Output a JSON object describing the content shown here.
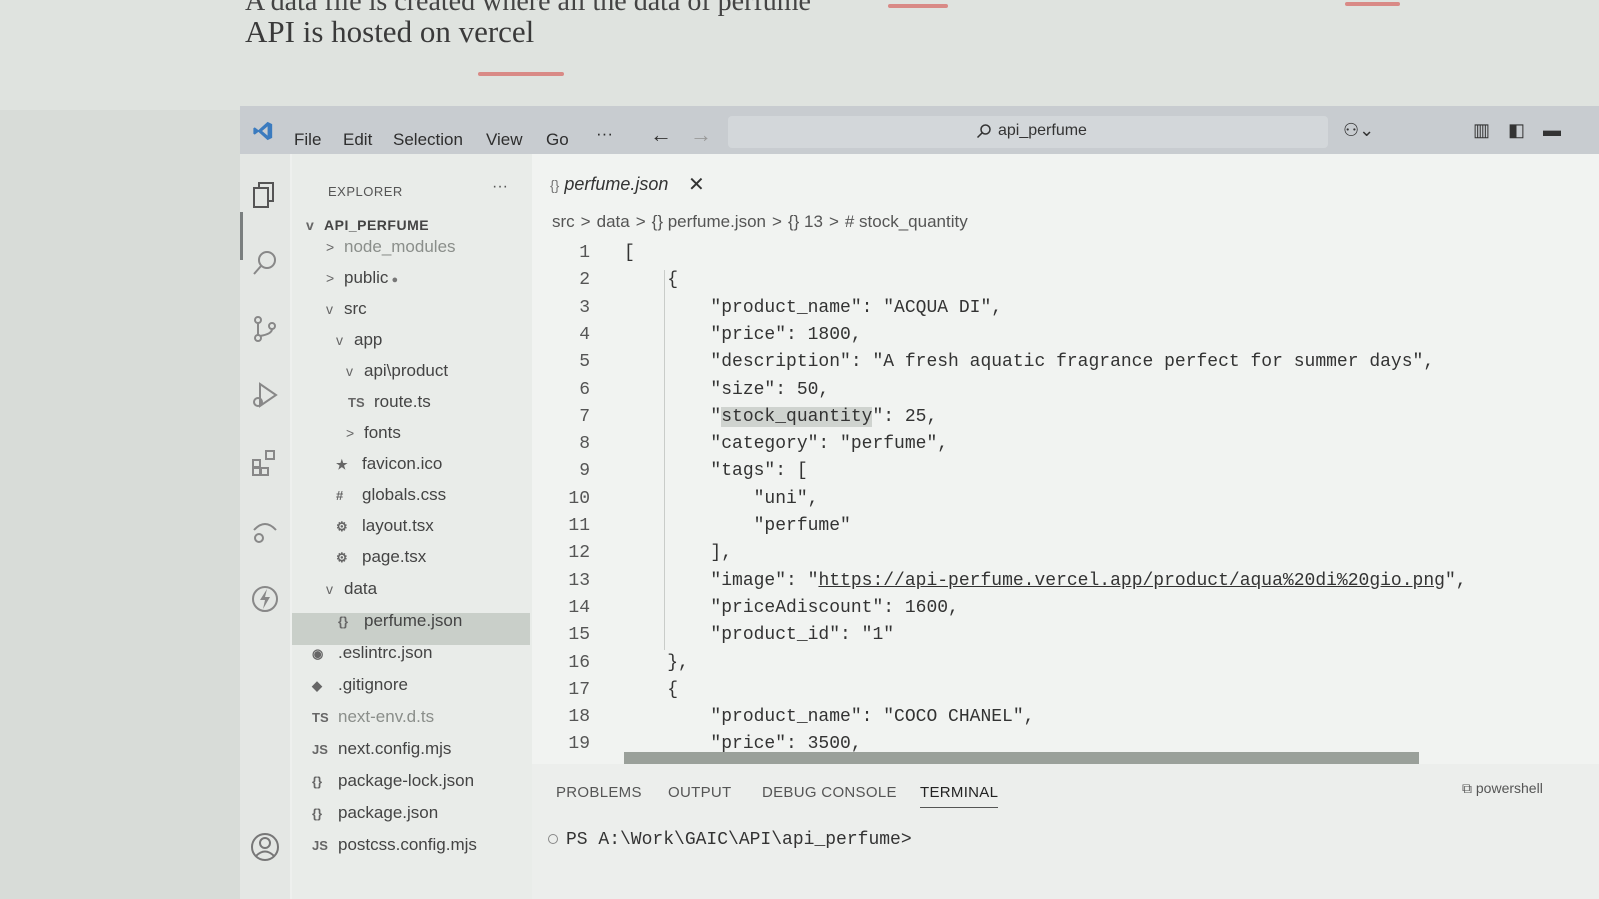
{
  "slide": {
    "partial_title": "A data file is created where all the data of perfume",
    "title": "API is hosted on vercel"
  },
  "titlebar": {
    "menu": [
      "File",
      "Edit",
      "Selection",
      "View",
      "Go",
      "···"
    ],
    "search": "api_perfume"
  },
  "explorer": {
    "header": "EXPLORER",
    "more": "···",
    "root": "API_PERFUME",
    "items": [
      {
        "label": "node_modules",
        "twisty": ">",
        "icon": "",
        "dim": true
      },
      {
        "label": "public",
        "twisty": ">",
        "icon": "",
        "dim": false
      },
      {
        "label": "src",
        "twisty": "v",
        "icon": "",
        "dim": false
      },
      {
        "label": "app",
        "twisty": "v",
        "icon": "",
        "dim": false
      },
      {
        "label": "api\\product",
        "twisty": "v",
        "icon": "",
        "dim": false
      },
      {
        "label": "route.ts",
        "twisty": "",
        "icon": "TS",
        "dim": false
      },
      {
        "label": "fonts",
        "twisty": ">",
        "icon": "",
        "dim": false
      },
      {
        "label": "favicon.ico",
        "twisty": "",
        "icon": "★",
        "dim": false
      },
      {
        "label": "globals.css",
        "twisty": "",
        "icon": "#",
        "dim": false
      },
      {
        "label": "layout.tsx",
        "twisty": "",
        "icon": "⚙",
        "dim": false
      },
      {
        "label": "page.tsx",
        "twisty": "",
        "icon": "⚙",
        "dim": false
      },
      {
        "label": "data",
        "twisty": "v",
        "icon": "",
        "dim": false
      },
      {
        "label": "perfume.json",
        "twisty": "",
        "icon": "{}",
        "dim": false
      },
      {
        "label": ".eslintrc.json",
        "twisty": "",
        "icon": "◉",
        "dim": false
      },
      {
        "label": ".gitignore",
        "twisty": "",
        "icon": "◆",
        "dim": false
      },
      {
        "label": "next-env.d.ts",
        "twisty": "",
        "icon": "TS",
        "dim": true
      },
      {
        "label": "next.config.mjs",
        "twisty": "",
        "icon": "JS",
        "dim": false
      },
      {
        "label": "package-lock.json",
        "twisty": "",
        "icon": "{}",
        "dim": false
      },
      {
        "label": "package.json",
        "twisty": "",
        "icon": "{}",
        "dim": false
      },
      {
        "label": "postcss.config.mjs",
        "twisty": "",
        "icon": "JS",
        "dim": false
      }
    ]
  },
  "editor": {
    "tab": "perfume.json",
    "breadcrumbs": [
      "src",
      ">",
      "data",
      ">",
      "{} perfume.json",
      ">",
      "{} 13",
      ">",
      "# stock_quantity"
    ],
    "lines": [
      "[",
      "    {",
      "        \"product_name\": \"ACQUA DI\",",
      "        \"price\": 1800,",
      "        \"description\": \"A fresh aquatic fragrance perfect for summer days\",",
      "        \"size\": 50,",
      "        \"stock_quantity\": 25,",
      "        \"category\": \"perfume\",",
      "        \"tags\": [",
      "            \"uni\",",
      "            \"perfume\"",
      "        ],",
      "        \"image\": \"https://api-perfume.vercel.app/product/aqua%20di%20gio.png\",",
      "        \"priceAdiscount\": 1600,",
      "        \"product_id\": \"1\"",
      "    },",
      "    {",
      "        \"product_name\": \"COCO CHANEL\",",
      "        \"price\": 3500,"
    ]
  },
  "panel": {
    "tabs": [
      "PROBLEMS",
      "OUTPUT",
      "DEBUG CONSOLE",
      "TERMINAL"
    ],
    "terminal_prompt": "PS A:\\Work\\GAIC\\API\\api_perfume>",
    "shell": "powershell"
  }
}
